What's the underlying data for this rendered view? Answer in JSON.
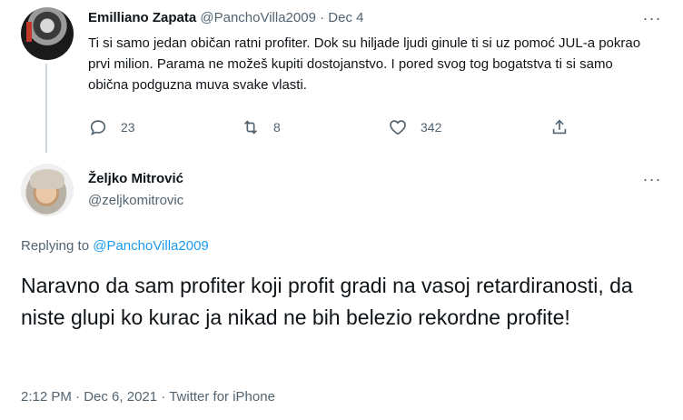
{
  "tweet1": {
    "author_name": "Emilliano Zapata",
    "handle": "@PanchoVilla2009",
    "separator": "·",
    "date": "Dec 4",
    "more_glyph": "···",
    "text": "Ti si samo jedan običan ratni profiter. Dok su hiljade ljudi ginule ti si uz pomoć JUL-a pokrao prvi milion. Parama ne možeš kupiti dostojanstvo. I pored svog tog bogatstva ti si samo obična podguzna muva svake vlasti.",
    "actions": {
      "reply_count": "23",
      "retweet_count": "8",
      "like_count": "342",
      "icons": [
        "reply-icon",
        "retweet-icon",
        "like-icon",
        "share-icon"
      ]
    }
  },
  "tweet2": {
    "author_name": "Željko Mitrović",
    "handle": "@zeljkomitrovic",
    "more_glyph": "···",
    "replying_prefix": "Replying to",
    "replying_to": "@PanchoVilla2009",
    "text": "Naravno da sam profiter koji profit gradi na vasoj retardiranosti, da niste glupi ko kurac ja nikad ne bih belezio rekordne profite!",
    "time": "2:12 PM",
    "separator1": "·",
    "date": "Dec 6, 2021",
    "separator2": "·",
    "source": "Twitter for iPhone"
  },
  "colors": {
    "text": "#0f1419",
    "secondary": "#536471",
    "link": "#1d9bf0",
    "thread_line": "#cfd9de"
  }
}
